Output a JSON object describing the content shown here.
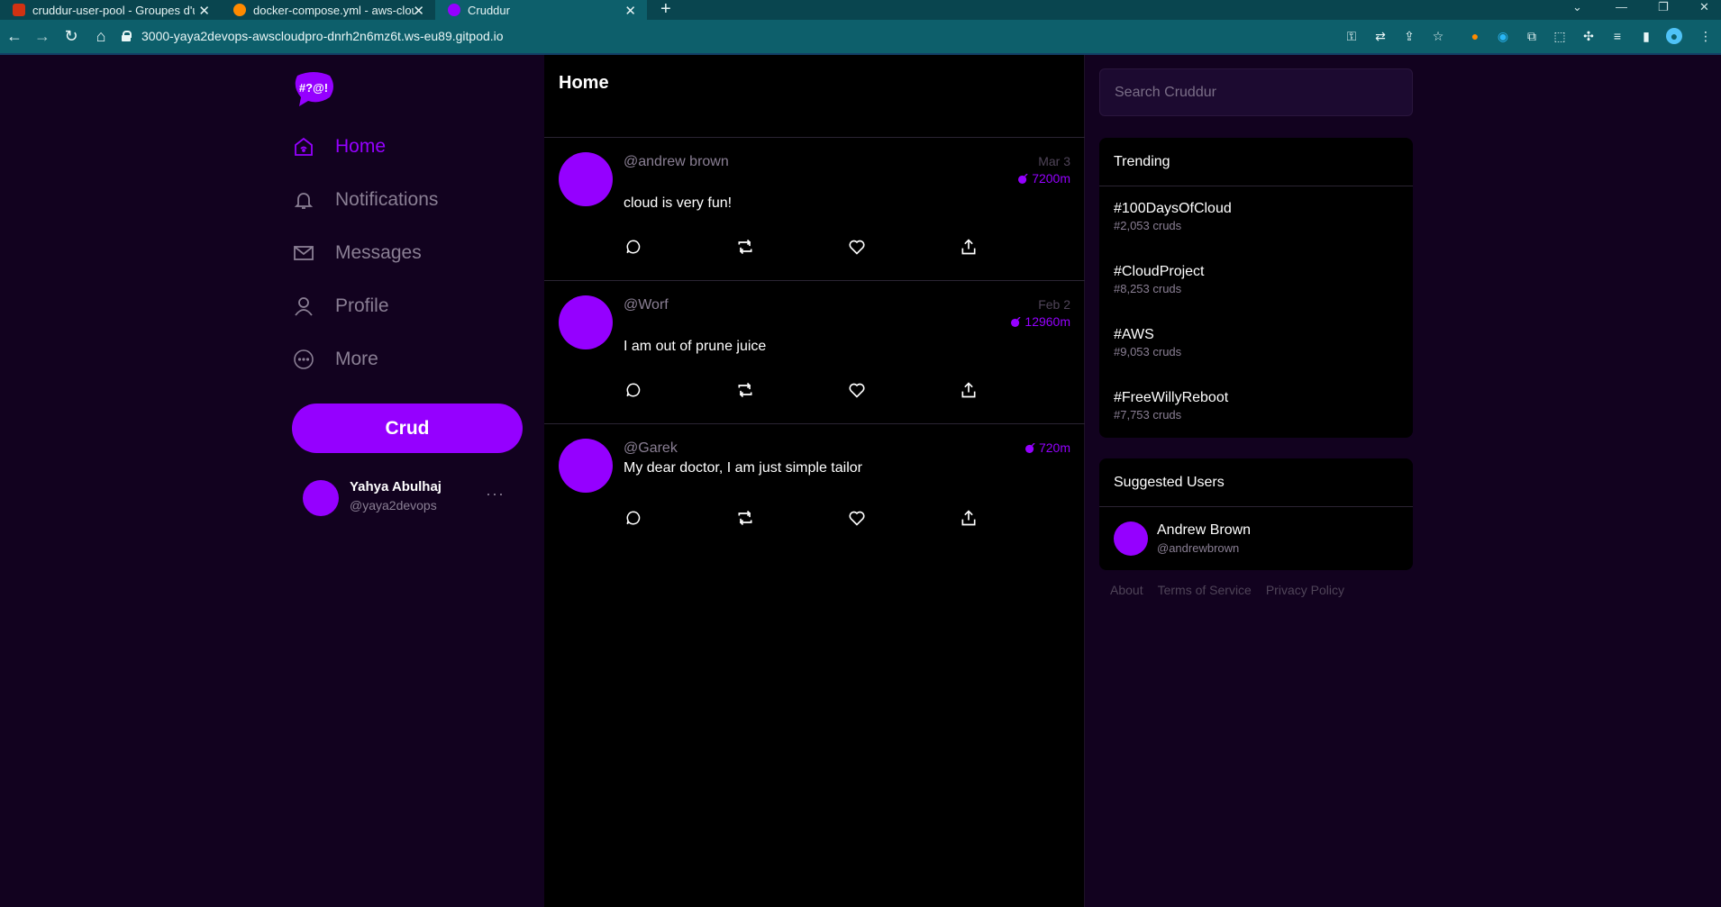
{
  "browser": {
    "tabs": [
      {
        "label": "cruddur-user-pool - Groupes d'u",
        "icon": "aws-icon",
        "active": false
      },
      {
        "label": "docker-compose.yml - aws-cloud",
        "icon": "gitpod-icon",
        "active": false
      },
      {
        "label": "Cruddur",
        "icon": "cruddur-icon",
        "active": true
      }
    ],
    "url": "3000-yaya2devops-awscloudpro-dnrh2n6mz6t.ws-eu89.gitpod.io",
    "accent": "#0d5f6b"
  },
  "sidebar": {
    "logo_text": "#?@!",
    "nav": [
      {
        "label": "Home",
        "icon": "home-icon",
        "active": true
      },
      {
        "label": "Notifications",
        "icon": "bell-icon",
        "active": false
      },
      {
        "label": "Messages",
        "icon": "mail-icon",
        "active": false
      },
      {
        "label": "Profile",
        "icon": "user-icon",
        "active": false
      },
      {
        "label": "More",
        "icon": "more-icon",
        "active": false
      }
    ],
    "crud_button": "Crud",
    "user": {
      "name": "Yahya Abulhaj",
      "handle": "@yaya2devops",
      "more": "···"
    }
  },
  "main": {
    "title": "Home",
    "cruds": [
      {
        "handle": "@andrew brown",
        "date": "Mar 3",
        "expires": "7200m",
        "text": "cloud is very fun!"
      },
      {
        "handle": "@Worf",
        "date": "Feb 2",
        "expires": "12960m",
        "text": "I am out of prune juice"
      },
      {
        "handle": "@Garek",
        "date": "",
        "expires": "720m",
        "text": "My dear doctor, I am just simple tailor"
      }
    ]
  },
  "right": {
    "search_placeholder": "Search Cruddur",
    "trending_title": "Trending",
    "trending": [
      {
        "tag": "#100DaysOfCloud",
        "count": "#2,053 cruds"
      },
      {
        "tag": "#CloudProject",
        "count": "#8,253 cruds"
      },
      {
        "tag": "#AWS",
        "count": "#9,053 cruds"
      },
      {
        "tag": "#FreeWillyReboot",
        "count": "#7,753 cruds"
      }
    ],
    "suggested_title": "Suggested Users",
    "suggested": [
      {
        "name": "Andrew Brown",
        "handle": "@andrewbrown"
      }
    ],
    "footer": [
      "About",
      "Terms of Service",
      "Privacy Policy"
    ]
  },
  "colors": {
    "brand": "#9500ff",
    "background": "#12021f",
    "feed": "#000000"
  }
}
